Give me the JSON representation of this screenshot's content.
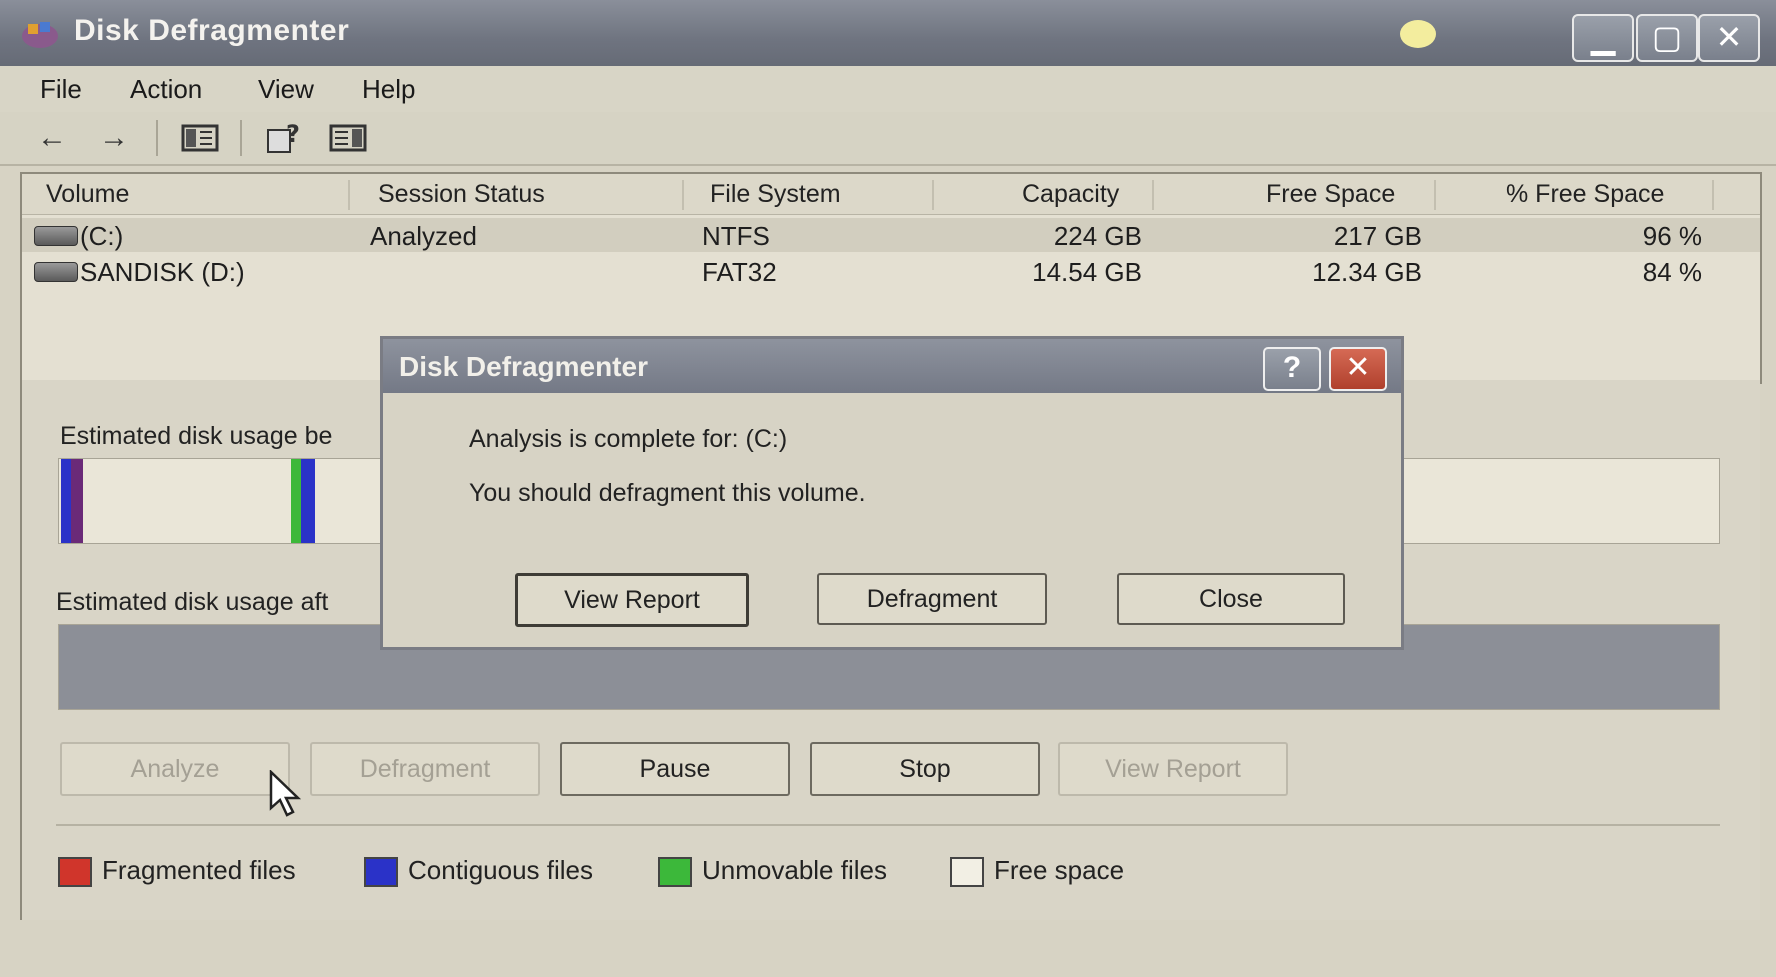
{
  "window": {
    "title": "Disk Defragmenter",
    "controls": {
      "minimize": "▁",
      "maximize": "▢",
      "close": "✕"
    }
  },
  "menu": {
    "file": "File",
    "action": "Action",
    "view": "View",
    "help": "Help"
  },
  "volume_list": {
    "columns": {
      "volume": "Volume",
      "session_status": "Session Status",
      "file_system": "File System",
      "capacity": "Capacity",
      "free_space": "Free Space",
      "pct_free": "% Free Space"
    },
    "rows": [
      {
        "volume": "(C:)",
        "status": "Analyzed",
        "fs": "NTFS",
        "capacity": "224 GB",
        "free": "217 GB",
        "pct": "96 %"
      },
      {
        "volume": "SANDISK (D:)",
        "status": "",
        "fs": "FAT32",
        "capacity": "14.54 GB",
        "free": "12.34 GB",
        "pct": "84 %"
      }
    ]
  },
  "usage": {
    "before_label": "Estimated disk usage be",
    "after_label": "Estimated disk usage aft"
  },
  "buttons": {
    "analyze": "Analyze",
    "defragment": "Defragment",
    "pause": "Pause",
    "stop": "Stop",
    "view_report": "View Report"
  },
  "legend": {
    "fragmented": "Fragmented files",
    "contiguous": "Contiguous files",
    "unmovable": "Unmovable files",
    "free": "Free space"
  },
  "colors": {
    "fragmented": "#d0352b",
    "contiguous": "#2a32c8",
    "unmovable": "#3cb83a",
    "free": "#f2efe4"
  },
  "dialog": {
    "title": "Disk Defragmenter",
    "help": "?",
    "close": "✕",
    "line1": "Analysis is complete for: (C:)",
    "line2": "You should defragment this volume.",
    "view_report": "View Report",
    "defragment": "Defragment",
    "close_button": "Close"
  }
}
